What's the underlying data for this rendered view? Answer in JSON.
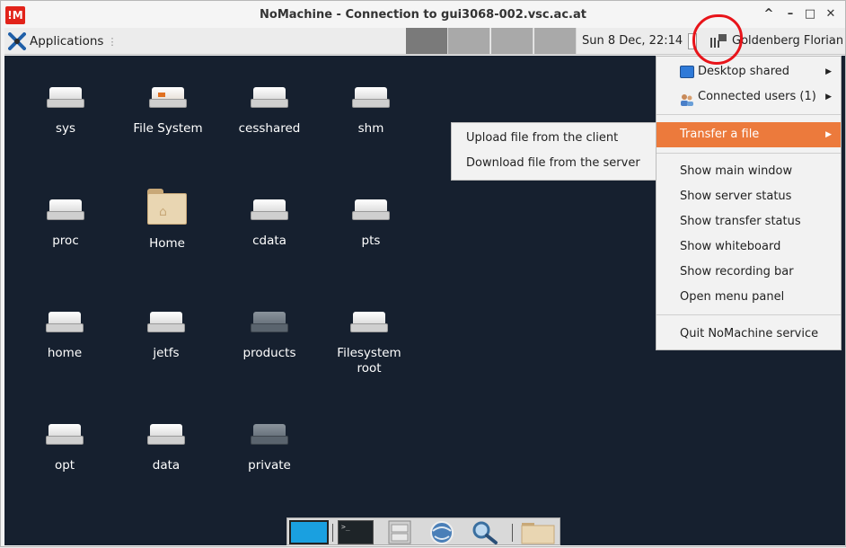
{
  "window": {
    "title": "NoMachine - Connection to gui3068-002.vsc.ac.at",
    "logo_text": "!M",
    "minimize_glyph": "–",
    "maximize_glyph": "□",
    "close_glyph": "✕",
    "collapse_glyph": "^"
  },
  "panel": {
    "applications_label": "Applications",
    "handle_glyph": "⋮",
    "clock": "Sun  8 Dec, 22:14",
    "user": "Goldenberg Florian",
    "workspaces": 4,
    "active_workspace": 1
  },
  "desktop": {
    "icons": [
      {
        "label": "sys"
      },
      {
        "label": "File System"
      },
      {
        "label": "cesshared"
      },
      {
        "label": "shm"
      },
      {
        "label": "proc"
      },
      {
        "label": "Home"
      },
      {
        "label": "cdata"
      },
      {
        "label": "pts"
      },
      {
        "label": "home"
      },
      {
        "label": "jetfs"
      },
      {
        "label": "products"
      },
      {
        "label": "Filesystem root"
      },
      {
        "label": "opt"
      },
      {
        "label": "data"
      },
      {
        "label": "private"
      }
    ]
  },
  "nx_menu": {
    "items": [
      {
        "label": "Desktop shared",
        "has_submenu": true
      },
      {
        "label": "Connected users (1)",
        "has_submenu": true
      },
      {
        "label": "Transfer a file",
        "has_submenu": true,
        "highlighted": true
      },
      {
        "label": "Show main window"
      },
      {
        "label": "Show server status"
      },
      {
        "label": "Show transfer status"
      },
      {
        "label": "Show whiteboard"
      },
      {
        "label": "Show recording bar"
      },
      {
        "label": "Open menu panel"
      },
      {
        "label": "Quit NoMachine service"
      }
    ],
    "submenu_arrow": "▶"
  },
  "transfer_submenu": {
    "items": [
      {
        "label": "Upload file from the client"
      },
      {
        "label": "Download file from the server"
      }
    ]
  },
  "colors": {
    "desktop_bg": "#16202f",
    "menu_highlight": "#ec7a3c",
    "annotation": "#e8141a",
    "logo": "#e2231a"
  }
}
